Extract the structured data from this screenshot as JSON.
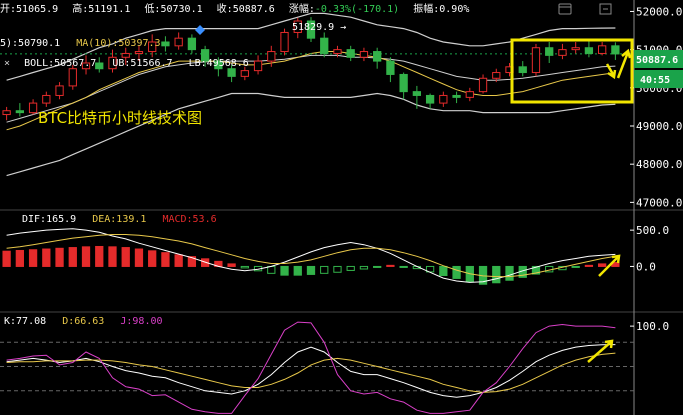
{
  "info_bar": {
    "open_label": "开:",
    "open": "51065.9",
    "high_label": "高:",
    "high": "51191.1",
    "low_label": "低:",
    "low": "50730.1",
    "close_label": "收:",
    "close": "50887.6",
    "change_label": "涨幅:",
    "change": "-0.33%(-170.1)",
    "amp_label": "振幅:",
    "amp": "0.90%"
  },
  "ma_line": {
    "ma5": "5):50790.1",
    "ma10": "MA(10):50397.3"
  },
  "boll_line": {
    "close_icon": "×",
    "boll": "BOLL:50567.7",
    "ub": "UB:51566.7",
    "lb": "LB:49568.6"
  },
  "annotations": {
    "title": "BTC比特币小时线技术图",
    "high_marker": "51829.9 →"
  },
  "price_tag": "50887.6",
  "countdown": "40:55",
  "macd_legend": {
    "dif": "DIF:165.9",
    "dea": "DEA:139.1",
    "macd": "MACD:53.6"
  },
  "kdj_legend": {
    "k": "K:77.08",
    "d": "D:66.63",
    "j": "J:98.00"
  },
  "colors": {
    "up": "#e52b2b",
    "down": "#33b34a",
    "boll": "#cfcfcf",
    "ma10": "#e8c84a",
    "dea": "#e8c84a",
    "j_line": "#d940c8",
    "highlight": "#f2e600",
    "price_tag": "#1aa34a"
  },
  "chart_data": [
    {
      "type": "candlestick",
      "title": "BTC比特币小时线技术图",
      "ylim": [
        46800,
        52300
      ],
      "yticks": [
        47000,
        48000,
        49000,
        50000,
        51000,
        52000
      ],
      "candles": [
        [
          49300,
          49400,
          49150,
          49500
        ],
        [
          49400,
          49350,
          49250,
          49600
        ],
        [
          49350,
          49600,
          49300,
          49700
        ],
        [
          49600,
          49800,
          49500,
          49900
        ],
        [
          49800,
          50050,
          49700,
          50150
        ],
        [
          50050,
          50500,
          49950,
          50600
        ],
        [
          50500,
          50650,
          50350,
          50850
        ],
        [
          50650,
          50500,
          50400,
          50800
        ],
        [
          50500,
          50800,
          50400,
          51000
        ],
        [
          50800,
          50900,
          50600,
          51050
        ],
        [
          50900,
          50950,
          50700,
          51100
        ],
        [
          50950,
          51200,
          50800,
          51400
        ],
        [
          51200,
          51100,
          50950,
          51350
        ],
        [
          51100,
          51300,
          51000,
          51450
        ],
        [
          51300,
          51000,
          50900,
          51400
        ],
        [
          51000,
          50700,
          50550,
          51100
        ],
        [
          50700,
          50500,
          50300,
          50800
        ],
        [
          50500,
          50300,
          50150,
          50600
        ],
        [
          50300,
          50450,
          50200,
          50550
        ],
        [
          50450,
          50700,
          50350,
          50850
        ],
        [
          50700,
          50950,
          50550,
          51100
        ],
        [
          50950,
          51450,
          50850,
          51550
        ],
        [
          51450,
          51750,
          51300,
          51830
        ],
        [
          51750,
          51300,
          51200,
          51850
        ],
        [
          51300,
          50900,
          50800,
          51450
        ],
        [
          50900,
          51000,
          50800,
          51100
        ],
        [
          51000,
          50800,
          50700,
          51100
        ],
        [
          50800,
          50950,
          50700,
          51050
        ],
        [
          50950,
          50700,
          50500,
          51050
        ],
        [
          50700,
          50350,
          50150,
          50800
        ],
        [
          50350,
          49900,
          49700,
          50400
        ],
        [
          49900,
          49800,
          49450,
          50050
        ],
        [
          49800,
          49600,
          49450,
          49850
        ],
        [
          49600,
          49800,
          49500,
          49900
        ],
        [
          49800,
          49750,
          49600,
          49900
        ],
        [
          49750,
          49900,
          49650,
          50000
        ],
        [
          49900,
          50250,
          49850,
          50350
        ],
        [
          50250,
          50400,
          50150,
          50500
        ],
        [
          50400,
          50550,
          50300,
          50650
        ],
        [
          50550,
          50400,
          50300,
          50700
        ],
        [
          50400,
          51050,
          50300,
          51150
        ],
        [
          51050,
          50850,
          50650,
          51200
        ],
        [
          50850,
          51000,
          50750,
          51150
        ],
        [
          51000,
          51050,
          50900,
          51200
        ],
        [
          51050,
          50900,
          50800,
          51250
        ],
        [
          50900,
          51100,
          50850,
          51200
        ],
        [
          51100,
          50887.6,
          50730.1,
          51191.1
        ]
      ],
      "boll_ub": [
        50200,
        50300,
        50400,
        50500,
        50600,
        50750,
        50900,
        51050,
        51150,
        51300,
        51400,
        51500,
        51550,
        51550,
        51550,
        51550,
        51550,
        51550,
        51550,
        51550,
        51650,
        51750,
        51850,
        51950,
        51950,
        51900,
        51850,
        51750,
        51650,
        51600,
        51550,
        51450,
        51300,
        51200,
        51150,
        51100,
        51100,
        51150,
        51200,
        51300,
        51400,
        51500,
        51550,
        51550,
        51560,
        51565,
        51566.7
      ],
      "boll_mid": [
        49100,
        49200,
        49300,
        49400,
        49500,
        49600,
        49750,
        49900,
        50050,
        50200,
        50350,
        50450,
        50550,
        50600,
        50650,
        50680,
        50700,
        50700,
        50700,
        50700,
        50720,
        50750,
        50800,
        50850,
        50850,
        50850,
        50800,
        50800,
        50780,
        50750,
        50700,
        50600,
        50500,
        50400,
        50300,
        50250,
        50200,
        50200,
        50220,
        50250,
        50300,
        50350,
        50400,
        50450,
        50500,
        50550,
        50567.7
      ],
      "boll_lb": [
        47700,
        47800,
        47900,
        48000,
        48100,
        48250,
        48400,
        48550,
        48700,
        48850,
        49000,
        49150,
        49300,
        49450,
        49550,
        49650,
        49750,
        49850,
        49850,
        49850,
        49800,
        49750,
        49750,
        49750,
        49750,
        49750,
        49750,
        49800,
        49850,
        49800,
        49700,
        49550,
        49450,
        49400,
        49400,
        49400,
        49350,
        49350,
        49350,
        49350,
        49350,
        49350,
        49400,
        49450,
        49500,
        49550,
        49568.6
      ],
      "ma10": [
        48900,
        49000,
        49150,
        49300,
        49450,
        49600,
        49750,
        49950,
        50100,
        50250,
        50400,
        50500,
        50600,
        50700,
        50700,
        50700,
        50700,
        50650,
        50600,
        50600,
        50650,
        50700,
        50800,
        50900,
        50950,
        50950,
        50900,
        50850,
        50800,
        50700,
        50550,
        50400,
        50250,
        50100,
        49950,
        49850,
        49800,
        49800,
        49850,
        49900,
        50000,
        50100,
        50200,
        50250,
        50300,
        50350,
        50397.3
      ]
    },
    {
      "type": "bar",
      "title": "MACD",
      "ylim": [
        -600,
        750
      ],
      "yticks": [
        0.0,
        500.0
      ],
      "macd": [
        210,
        220,
        230,
        240,
        250,
        260,
        270,
        275,
        270,
        260,
        240,
        215,
        190,
        160,
        135,
        105,
        70,
        35,
        -20,
        -60,
        -95,
        -120,
        -120,
        -110,
        -95,
        -80,
        -55,
        -35,
        -10,
        15,
        -5,
        -30,
        -75,
        -125,
        -165,
        -210,
        -245,
        -225,
        -190,
        -150,
        -105,
        -75,
        -45,
        -10,
        15,
        35,
        53.6
      ],
      "dif": [
        430,
        460,
        480,
        500,
        510,
        520,
        500,
        470,
        420,
        380,
        320,
        270,
        220,
        170,
        120,
        60,
        0,
        -40,
        -60,
        -40,
        0,
        60,
        130,
        200,
        260,
        300,
        330,
        300,
        250,
        180,
        90,
        0,
        -80,
        -160,
        -200,
        -220,
        -210,
        -170,
        -120,
        -60,
        -10,
        40,
        80,
        110,
        140,
        155,
        165.9
      ],
      "dea": [
        250,
        270,
        300,
        330,
        360,
        390,
        410,
        430,
        440,
        440,
        430,
        410,
        380,
        350,
        310,
        260,
        210,
        160,
        110,
        70,
        40,
        40,
        60,
        90,
        140,
        190,
        230,
        250,
        250,
        230,
        190,
        140,
        80,
        10,
        -50,
        -100,
        -130,
        -140,
        -140,
        -120,
        -90,
        -50,
        -10,
        30,
        70,
        110,
        139.1
      ]
    },
    {
      "type": "line",
      "title": "KDJ",
      "ylim": [
        -10,
        115
      ],
      "yticks": [
        100.0
      ],
      "gridlines": [
        80,
        50,
        20
      ],
      "k": [
        56,
        58,
        60,
        58,
        55,
        57,
        60,
        56,
        50,
        45,
        42,
        38,
        36,
        30,
        25,
        20,
        18,
        16,
        20,
        28,
        40,
        55,
        68,
        74,
        68,
        55,
        44,
        40,
        40,
        35,
        30,
        24,
        18,
        14,
        12,
        14,
        18,
        24,
        33,
        44,
        56,
        64,
        70,
        74,
        76,
        77,
        77.08
      ],
      "d": [
        55,
        56,
        56,
        57,
        57,
        57,
        58,
        58,
        57,
        55,
        52,
        50,
        46,
        42,
        38,
        34,
        30,
        26,
        24,
        24,
        28,
        34,
        42,
        52,
        58,
        60,
        58,
        54,
        50,
        46,
        42,
        38,
        34,
        28,
        24,
        20,
        18,
        19,
        22,
        28,
        36,
        44,
        52,
        58,
        62,
        65,
        66.63
      ],
      "j": [
        58,
        60,
        63,
        64,
        52,
        55,
        68,
        60,
        36,
        25,
        22,
        14,
        15,
        6,
        -3,
        -6,
        -8,
        -8,
        14,
        35,
        65,
        95,
        105,
        104,
        80,
        40,
        20,
        16,
        18,
        10,
        6,
        -4,
        -8,
        -8,
        -6,
        -4,
        18,
        30,
        50,
        72,
        92,
        100,
        102,
        100,
        100,
        100,
        98.0
      ]
    }
  ]
}
